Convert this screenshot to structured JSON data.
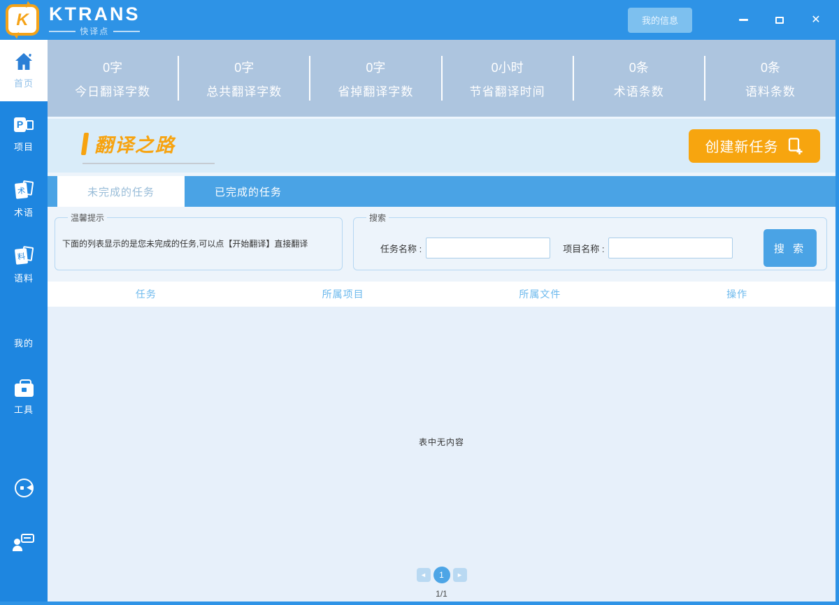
{
  "colors": {
    "titlebar_blue": "#2e93e6",
    "sidebar_blue": "#1e86e0",
    "stats_blue_gray": "#adc5df",
    "tab_blue": "#4aa3e5",
    "accent_orange": "#f7a50f"
  },
  "titlebar": {
    "logo_letter": "K",
    "brand": "KTRANS",
    "brand_sub": "快译点",
    "my_info": "我的信息",
    "close_glyph": "✕"
  },
  "sidebar": {
    "items": [
      {
        "label": "首页",
        "icon": "home-icon",
        "active": true
      },
      {
        "label": "项目",
        "icon": "project-icon",
        "glyph": "P"
      },
      {
        "label": "术语",
        "icon": "terminology-icon",
        "glyph": "术"
      },
      {
        "label": "语料",
        "icon": "corpus-icon",
        "glyph": "料"
      },
      {
        "label": "我的",
        "icon": "profile-icon"
      },
      {
        "label": "工具",
        "icon": "tools-icon"
      }
    ],
    "footer_icons": [
      "customer-service-icon",
      "feedback-icon"
    ]
  },
  "stats": {
    "items": [
      {
        "value": "0字",
        "label": "今日翻译字数"
      },
      {
        "value": "0字",
        "label": "总共翻译字数"
      },
      {
        "value": "0字",
        "label": "省掉翻译字数"
      },
      {
        "value": "0小时",
        "label": "节省翻译时间"
      },
      {
        "value": "0条",
        "label": "术语条数"
      },
      {
        "value": "0条",
        "label": "语料条数"
      }
    ]
  },
  "main": {
    "section_title": "翻译之路",
    "create_task": "创建新任务",
    "tabs": [
      {
        "label": "未完成的任务",
        "active": true
      },
      {
        "label": "已完成的任务",
        "active": false
      }
    ],
    "tip": {
      "legend": "温馨提示",
      "text": "下面的列表显示的是您未完成的任务,可以点【开始翻译】直接翻译"
    },
    "search": {
      "legend": "搜索",
      "task_label": "任务名称 :",
      "task_value": "",
      "project_label": "项目名称 :",
      "project_value": "",
      "button": "搜 索"
    },
    "table": {
      "columns": [
        "任务",
        "所属项目",
        "所属文件",
        "操作"
      ],
      "empty_text": "表中无内容"
    },
    "pagination": {
      "prev": "◄",
      "page": "1",
      "next": "►",
      "summary": "1/1"
    }
  }
}
